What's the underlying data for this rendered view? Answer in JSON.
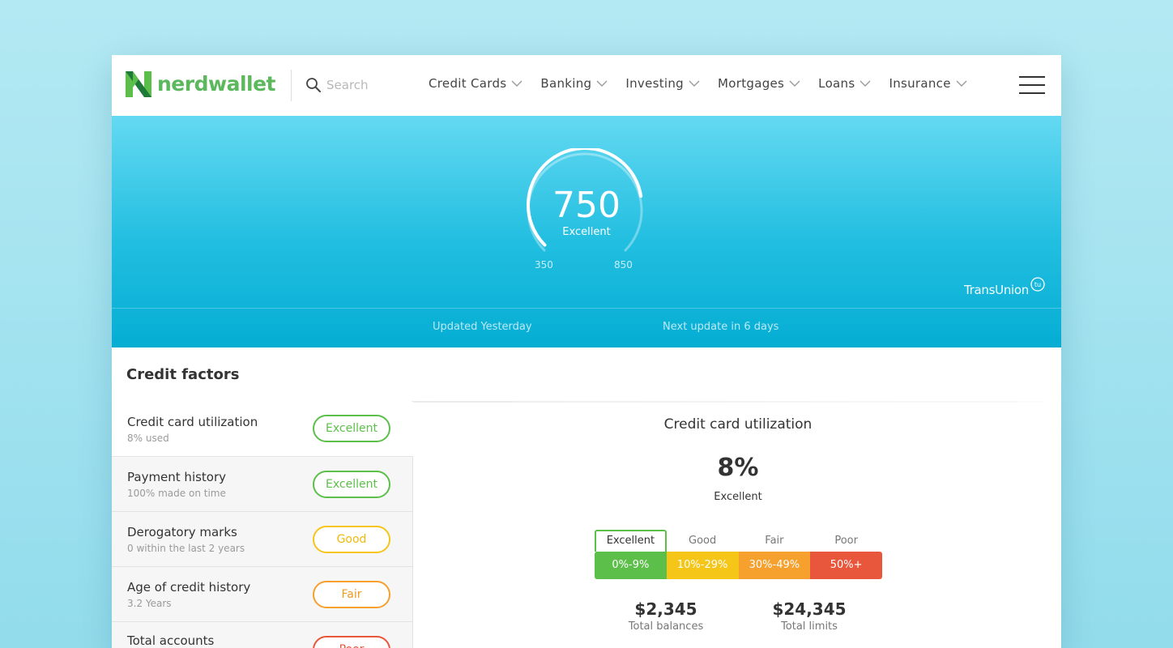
{
  "header": {
    "logo_text": "nerdwallet",
    "search_placeholder": "Search",
    "nav": [
      {
        "label": "Credit Cards"
      },
      {
        "label": "Banking"
      },
      {
        "label": "Investing"
      },
      {
        "label": "Mortgages"
      },
      {
        "label": "Loans"
      },
      {
        "label": "Insurance"
      }
    ],
    "menu_icon": "hamburger-menu-icon"
  },
  "hero": {
    "score": "750",
    "score_label": "Excellent",
    "score_value": 750,
    "range_min": "350",
    "range_max": "850",
    "bureau": "TransUnion",
    "updated": "Updated Yesterday",
    "next_update": "Next update in 6 days"
  },
  "factors": {
    "title": "Credit factors",
    "items": [
      {
        "name": "Credit card utilization",
        "sub": "8% used",
        "rating": "Excellent"
      },
      {
        "name": "Payment history",
        "sub": "100% made on time",
        "rating": "Excellent"
      },
      {
        "name": "Derogatory marks",
        "sub": "0 within the last 2 years",
        "rating": "Good"
      },
      {
        "name": "Age of credit history",
        "sub": "3.2 Years",
        "rating": "Fair"
      },
      {
        "name": "Total accounts",
        "sub": "",
        "rating": "Poor"
      }
    ]
  },
  "detail": {
    "title": "Credit card utilization",
    "value": "8%",
    "rating": "Excellent",
    "scale": [
      {
        "label": "Excellent",
        "range": "0%-9%"
      },
      {
        "label": "Good",
        "range": "10%-29%"
      },
      {
        "label": "Fair",
        "range": "30%-49%"
      },
      {
        "label": "Poor",
        "range": "50%+"
      }
    ],
    "totals": [
      {
        "value": "$2,345",
        "label": "Total balances"
      },
      {
        "value": "$24,345",
        "label": "Total limits"
      }
    ]
  },
  "colors": {
    "brand_green": "#5cbf4a",
    "hero_top": "#64d9f2",
    "hero_bottom": "#05add3",
    "excellent": "#5cbf4a",
    "good": "#f5c518",
    "fair": "#f6a02d",
    "poor": "#e8563b"
  }
}
